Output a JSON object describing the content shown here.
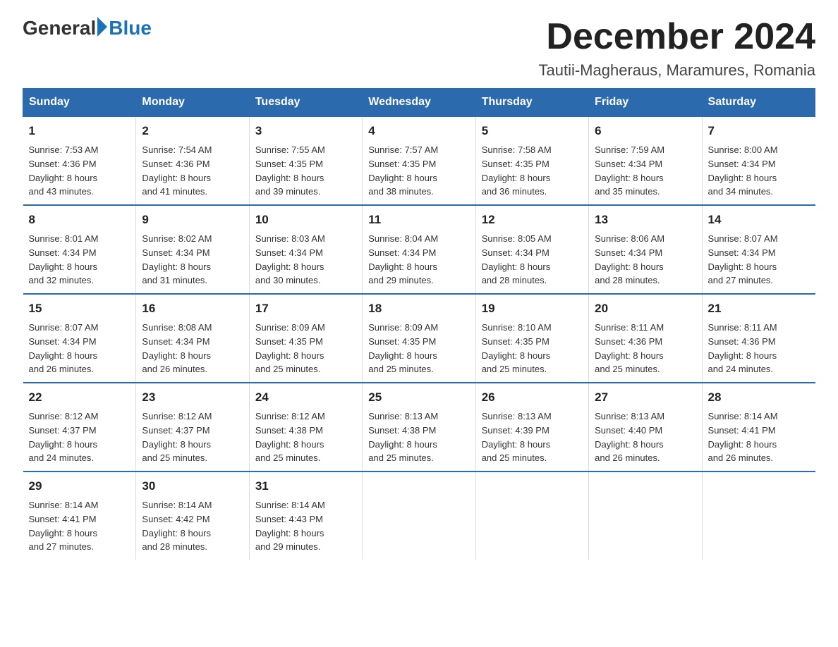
{
  "logo": {
    "general": "General",
    "blue": "Blue"
  },
  "title": "December 2024",
  "subtitle": "Tautii-Magheraus, Maramures, Romania",
  "headers": [
    "Sunday",
    "Monday",
    "Tuesday",
    "Wednesday",
    "Thursday",
    "Friday",
    "Saturday"
  ],
  "weeks": [
    [
      {
        "day": "1",
        "sunrise": "7:53 AM",
        "sunset": "4:36 PM",
        "daylight": "8 hours and 43 minutes."
      },
      {
        "day": "2",
        "sunrise": "7:54 AM",
        "sunset": "4:36 PM",
        "daylight": "8 hours and 41 minutes."
      },
      {
        "day": "3",
        "sunrise": "7:55 AM",
        "sunset": "4:35 PM",
        "daylight": "8 hours and 39 minutes."
      },
      {
        "day": "4",
        "sunrise": "7:57 AM",
        "sunset": "4:35 PM",
        "daylight": "8 hours and 38 minutes."
      },
      {
        "day": "5",
        "sunrise": "7:58 AM",
        "sunset": "4:35 PM",
        "daylight": "8 hours and 36 minutes."
      },
      {
        "day": "6",
        "sunrise": "7:59 AM",
        "sunset": "4:34 PM",
        "daylight": "8 hours and 35 minutes."
      },
      {
        "day": "7",
        "sunrise": "8:00 AM",
        "sunset": "4:34 PM",
        "daylight": "8 hours and 34 minutes."
      }
    ],
    [
      {
        "day": "8",
        "sunrise": "8:01 AM",
        "sunset": "4:34 PM",
        "daylight": "8 hours and 32 minutes."
      },
      {
        "day": "9",
        "sunrise": "8:02 AM",
        "sunset": "4:34 PM",
        "daylight": "8 hours and 31 minutes."
      },
      {
        "day": "10",
        "sunrise": "8:03 AM",
        "sunset": "4:34 PM",
        "daylight": "8 hours and 30 minutes."
      },
      {
        "day": "11",
        "sunrise": "8:04 AM",
        "sunset": "4:34 PM",
        "daylight": "8 hours and 29 minutes."
      },
      {
        "day": "12",
        "sunrise": "8:05 AM",
        "sunset": "4:34 PM",
        "daylight": "8 hours and 28 minutes."
      },
      {
        "day": "13",
        "sunrise": "8:06 AM",
        "sunset": "4:34 PM",
        "daylight": "8 hours and 28 minutes."
      },
      {
        "day": "14",
        "sunrise": "8:07 AM",
        "sunset": "4:34 PM",
        "daylight": "8 hours and 27 minutes."
      }
    ],
    [
      {
        "day": "15",
        "sunrise": "8:07 AM",
        "sunset": "4:34 PM",
        "daylight": "8 hours and 26 minutes."
      },
      {
        "day": "16",
        "sunrise": "8:08 AM",
        "sunset": "4:34 PM",
        "daylight": "8 hours and 26 minutes."
      },
      {
        "day": "17",
        "sunrise": "8:09 AM",
        "sunset": "4:35 PM",
        "daylight": "8 hours and 25 minutes."
      },
      {
        "day": "18",
        "sunrise": "8:09 AM",
        "sunset": "4:35 PM",
        "daylight": "8 hours and 25 minutes."
      },
      {
        "day": "19",
        "sunrise": "8:10 AM",
        "sunset": "4:35 PM",
        "daylight": "8 hours and 25 minutes."
      },
      {
        "day": "20",
        "sunrise": "8:11 AM",
        "sunset": "4:36 PM",
        "daylight": "8 hours and 25 minutes."
      },
      {
        "day": "21",
        "sunrise": "8:11 AM",
        "sunset": "4:36 PM",
        "daylight": "8 hours and 24 minutes."
      }
    ],
    [
      {
        "day": "22",
        "sunrise": "8:12 AM",
        "sunset": "4:37 PM",
        "daylight": "8 hours and 24 minutes."
      },
      {
        "day": "23",
        "sunrise": "8:12 AM",
        "sunset": "4:37 PM",
        "daylight": "8 hours and 25 minutes."
      },
      {
        "day": "24",
        "sunrise": "8:12 AM",
        "sunset": "4:38 PM",
        "daylight": "8 hours and 25 minutes."
      },
      {
        "day": "25",
        "sunrise": "8:13 AM",
        "sunset": "4:38 PM",
        "daylight": "8 hours and 25 minutes."
      },
      {
        "day": "26",
        "sunrise": "8:13 AM",
        "sunset": "4:39 PM",
        "daylight": "8 hours and 25 minutes."
      },
      {
        "day": "27",
        "sunrise": "8:13 AM",
        "sunset": "4:40 PM",
        "daylight": "8 hours and 26 minutes."
      },
      {
        "day": "28",
        "sunrise": "8:14 AM",
        "sunset": "4:41 PM",
        "daylight": "8 hours and 26 minutes."
      }
    ],
    [
      {
        "day": "29",
        "sunrise": "8:14 AM",
        "sunset": "4:41 PM",
        "daylight": "8 hours and 27 minutes."
      },
      {
        "day": "30",
        "sunrise": "8:14 AM",
        "sunset": "4:42 PM",
        "daylight": "8 hours and 28 minutes."
      },
      {
        "day": "31",
        "sunrise": "8:14 AM",
        "sunset": "4:43 PM",
        "daylight": "8 hours and 29 minutes."
      },
      null,
      null,
      null,
      null
    ]
  ],
  "labels": {
    "sunrise": "Sunrise:",
    "sunset": "Sunset:",
    "daylight": "Daylight:"
  }
}
